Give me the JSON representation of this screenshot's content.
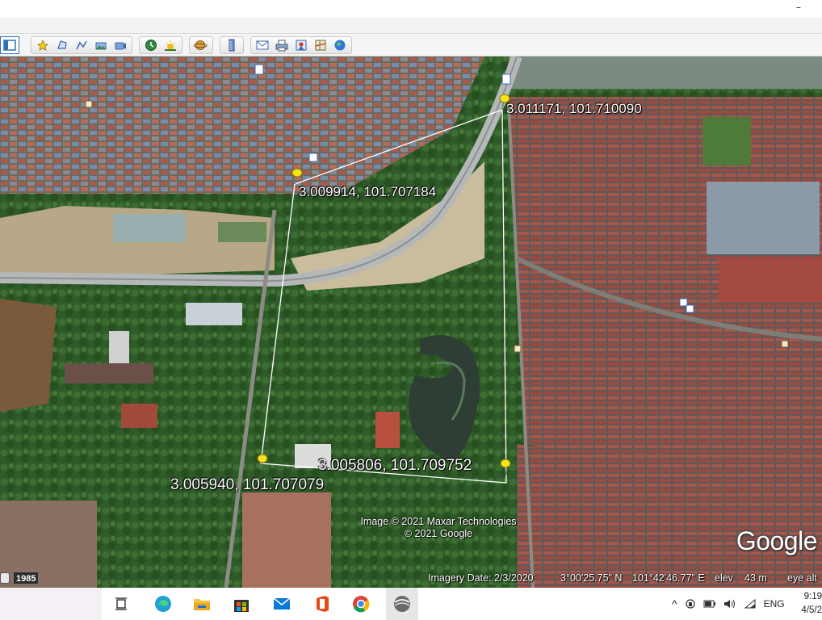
{
  "window": {
    "minimize_glyph": "–"
  },
  "toolbar": {
    "groups": [
      [
        "add-placemark-icon",
        "add-polygon-icon",
        "add-path-icon",
        "add-image-overlay-icon",
        "record-tour-icon"
      ],
      [
        "historical-imagery-icon",
        "sunlight-icon"
      ],
      [
        "switch-planet-icon"
      ],
      [
        "ruler-icon"
      ],
      [
        "email-icon",
        "print-icon",
        "save-image-icon",
        "view-in-maps-icon",
        "earth-gallery-icon"
      ]
    ]
  },
  "placemarks": [
    {
      "label": "3.011171, 101.710090"
    },
    {
      "label": "3.009914, 101.707184"
    },
    {
      "label": "3.005806, 101.709752"
    },
    {
      "label": "3.005940, 101.707079"
    }
  ],
  "attribution": {
    "line1": "Image © 2021 Maxar Technologies",
    "line2": "© 2021 Google"
  },
  "logo": "Google",
  "status": {
    "year": "1985",
    "imagery_date": "Imagery Date: 2/3/2020",
    "lat": "3°00'25.75\" N",
    "lon": "101°42'46.77\" E",
    "elev_label": "elev",
    "elev_value": "43 m",
    "eye_alt": "eye alt"
  },
  "taskbar": {
    "apps": [
      "task-view-icon",
      "edge-icon",
      "file-explorer-icon",
      "store-icon",
      "mail-icon",
      "office-icon",
      "chrome-icon",
      "google-earth-icon"
    ],
    "language": "ENG",
    "time": "9:19",
    "date": "4/5/2"
  },
  "colors": {
    "path_line": "#ffffff",
    "pin": "#f5e31a",
    "taskbar": "#ffffff"
  }
}
